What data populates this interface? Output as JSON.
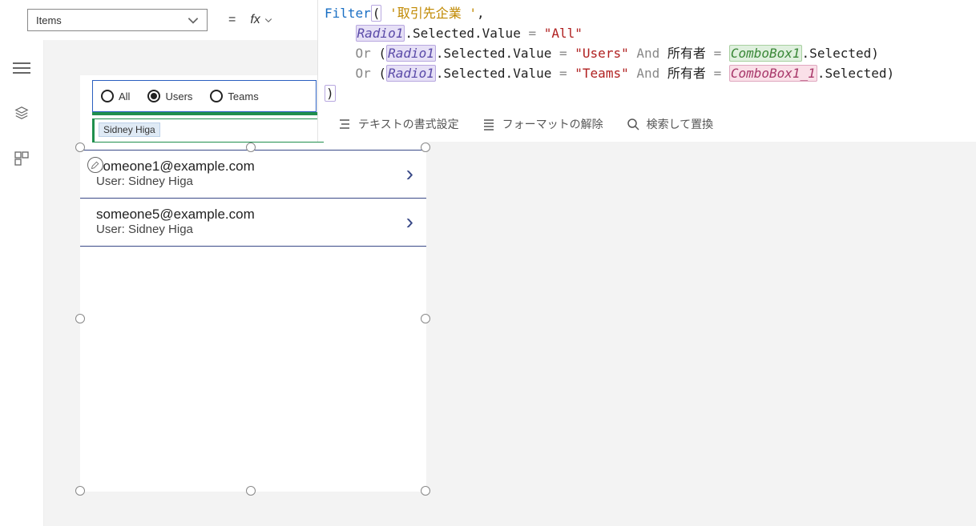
{
  "property": {
    "name": "Items"
  },
  "formula": {
    "func": "Filter",
    "table": "'取引先企業 '",
    "ref_radio": "Radio1",
    "ref_combo1": "ComboBox1",
    "ref_combo2": "ComboBox1_1",
    "sel_path": ".Selected.Value",
    "sel_suffix": ".Selected",
    "str_all": "\"All\"",
    "str_users": "\"Users\"",
    "str_teams": "\"Teams\"",
    "kw_or": "Or",
    "kw_and": "And",
    "owner": "所有者",
    "eq": "="
  },
  "formula_toolbar": {
    "format": "テキストの書式設定",
    "unformat": "フォーマットの解除",
    "find": "検索して置換"
  },
  "radio": {
    "opt_all": "All",
    "opt_users": "Users",
    "opt_teams": "Teams",
    "selected": "Users"
  },
  "combobox": {
    "selected": "Sidney Higa"
  },
  "gallery": [
    {
      "title": "someone1@example.com",
      "subtitle": "User: Sidney Higa"
    },
    {
      "title": "someone5@example.com",
      "subtitle": "User: Sidney Higa"
    }
  ]
}
